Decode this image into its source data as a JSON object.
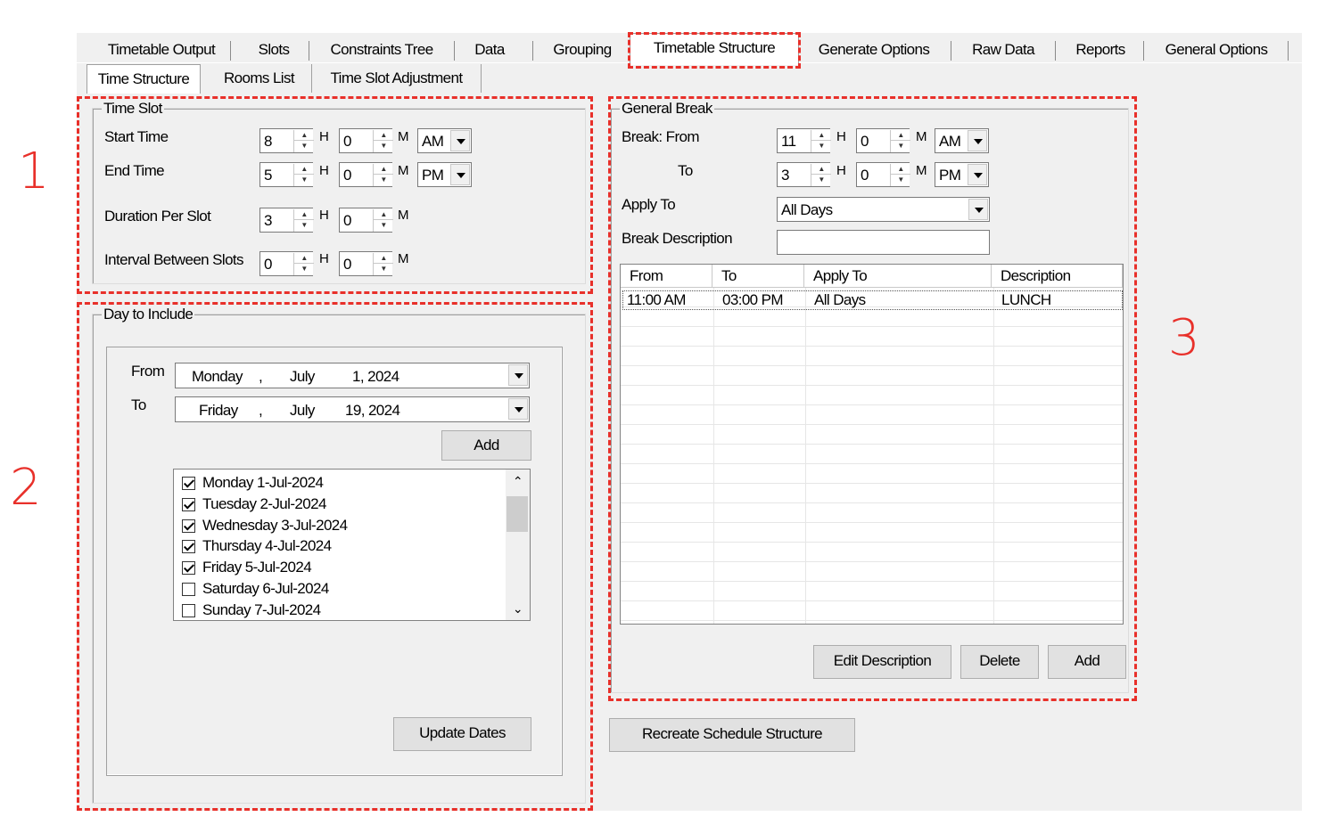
{
  "top_tabs": [
    {
      "label": "Timetable Output"
    },
    {
      "label": "Slots"
    },
    {
      "label": "Constraints Tree"
    },
    {
      "label": "Data"
    },
    {
      "label": "Grouping"
    },
    {
      "label": "Timetable Structure",
      "selected": true
    },
    {
      "label": "Generate Options"
    },
    {
      "label": "Raw Data"
    },
    {
      "label": "Reports"
    },
    {
      "label": "General Options"
    }
  ],
  "sub_tabs": [
    {
      "label": "Time Structure",
      "selected": true
    },
    {
      "label": "Rooms List"
    },
    {
      "label": "Time Slot Adjustment"
    }
  ],
  "annotations": {
    "n1": "1",
    "n2": "2",
    "n3": "3"
  },
  "time_slot": {
    "title": "Time Slot",
    "start_label": "Start Time",
    "end_label": "End Time",
    "duration_label": "Duration Per Slot",
    "interval_label": "Interval Between Slots",
    "start": {
      "h": "8",
      "m": "0",
      "ampm": "AM"
    },
    "end": {
      "h": "5",
      "m": "0",
      "ampm": "PM"
    },
    "duration": {
      "h": "3",
      "m": "0"
    },
    "interval": {
      "h": "0",
      "m": "0"
    },
    "h_unit": "H",
    "m_unit": "M"
  },
  "days": {
    "title": "Day to Include",
    "from_label": "From",
    "to_label": "To",
    "from_date": {
      "weekday": "Monday",
      "sep": ",",
      "month": "July",
      "day_year": "1, 2024"
    },
    "to_date": {
      "weekday": "Friday",
      "sep": ",",
      "month": "July",
      "day_year": "19, 2024"
    },
    "add_button": "Add",
    "update_button": "Update Dates",
    "list": [
      {
        "label": "Monday 1-Jul-2024",
        "checked": true
      },
      {
        "label": "Tuesday 2-Jul-2024",
        "checked": true
      },
      {
        "label": "Wednesday 3-Jul-2024",
        "checked": true
      },
      {
        "label": "Thursday 4-Jul-2024",
        "checked": true
      },
      {
        "label": "Friday 5-Jul-2024",
        "checked": true
      },
      {
        "label": "Saturday 6-Jul-2024",
        "checked": false
      },
      {
        "label": "Sunday 7-Jul-2024",
        "checked": false
      }
    ]
  },
  "general_break": {
    "title": "General Break",
    "from_label": "Break: From",
    "to_label": "To",
    "apply_label": "Apply To",
    "desc_label": "Break Description",
    "from": {
      "h": "11",
      "m": "0",
      "ampm": "AM"
    },
    "to": {
      "h": "3",
      "m": "0",
      "ampm": "PM"
    },
    "apply_value": "All Days",
    "desc_value": "",
    "columns": [
      "From",
      "To",
      "Apply To",
      "Description"
    ],
    "rows": [
      [
        "11:00 AM",
        "03:00 PM",
        "All Days",
        "LUNCH"
      ]
    ],
    "edit_button": "Edit Description",
    "delete_button": "Delete",
    "add_button": "Add"
  },
  "recreate_button": "Recreate Schedule Structure",
  "colors": {
    "annotation": "#e8302a",
    "window_bg": "#f0f0f0"
  }
}
